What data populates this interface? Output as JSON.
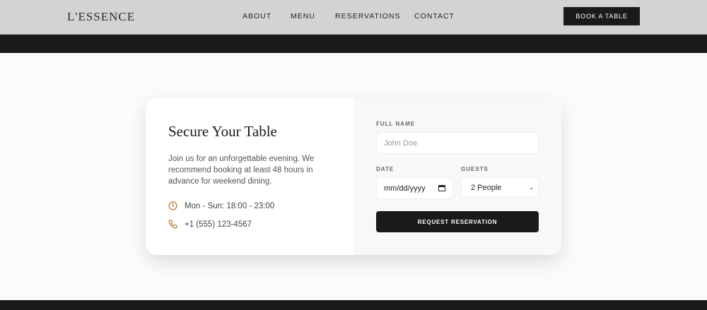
{
  "header": {
    "logo": "L'ESSENCE",
    "nav": [
      "ABOUT",
      "MENU",
      "RESERVATIONS",
      "CONTACT"
    ],
    "cta": "BOOK A TABLE"
  },
  "reservation": {
    "title": "Secure Your Table",
    "description": "Join us for an unforgettable evening. We recommend booking at least 48 hours in advance for weekend dining.",
    "hours": "Mon - Sun: 18:00 - 23:00",
    "phone": "+1 (555) 123-4567",
    "accent_color": "#b5651d",
    "form": {
      "name_label": "FULL NAME",
      "name_placeholder": "John Doe",
      "date_label": "DATE",
      "date_placeholder": "mm/dd/yyyy",
      "guests_label": "GUESTS",
      "guests_value": "2 People",
      "submit": "REQUEST RESERVATION"
    }
  }
}
